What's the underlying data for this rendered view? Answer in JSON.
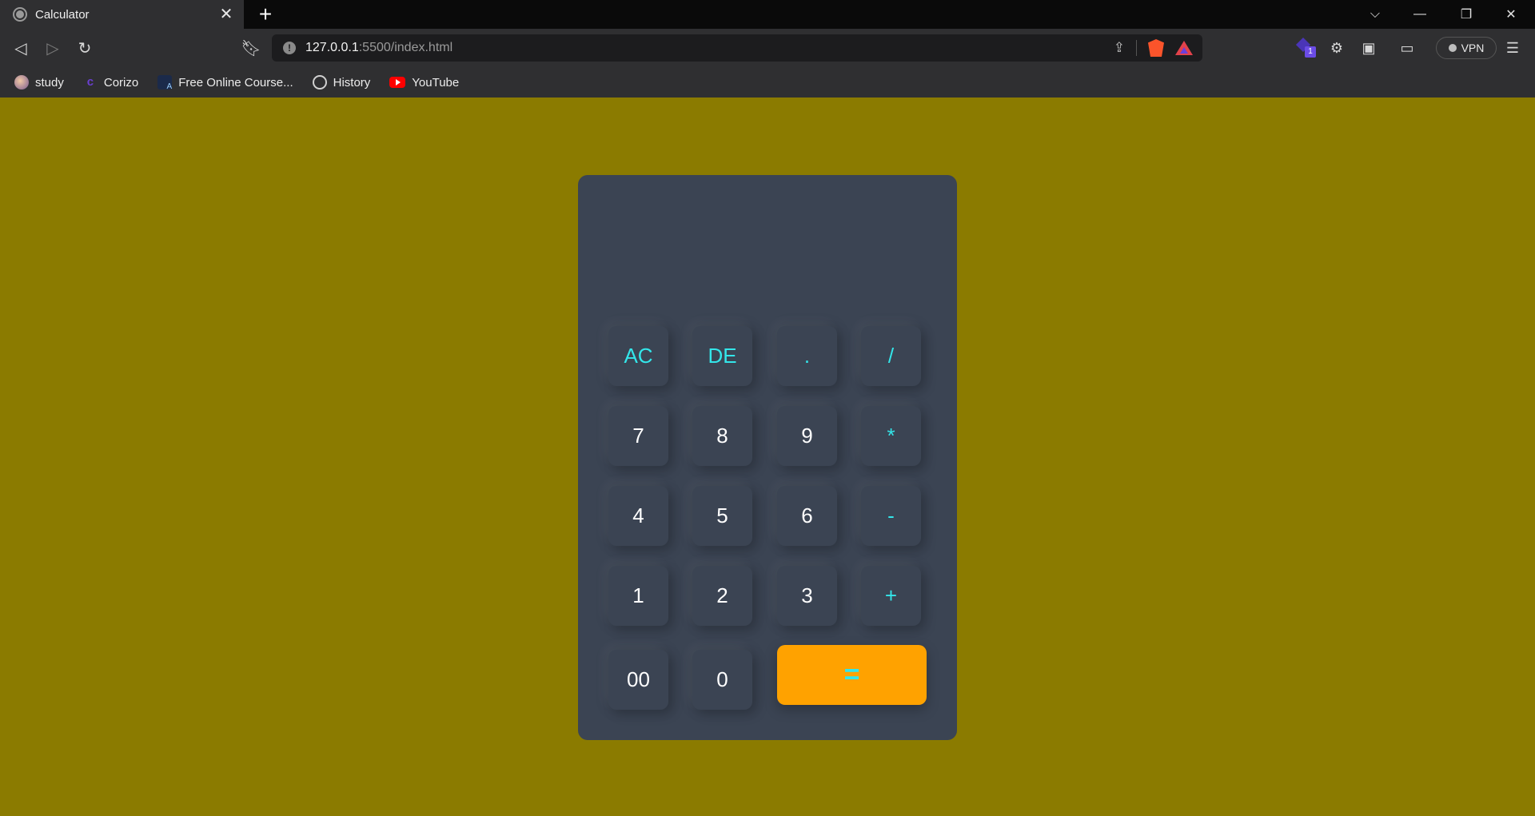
{
  "browser": {
    "tab_title": "Calculator",
    "url_host": "127.0.0.1",
    "url_rest": ":5500/index.html",
    "vpn_label": "VPN",
    "extension_badge": "1",
    "icons": [
      "globe-icon",
      "close-icon",
      "plus-icon",
      "back-icon",
      "forward-icon",
      "reload-icon",
      "bookmark-icon",
      "info-icon",
      "share-icon",
      "brave-shields-icon",
      "brave-rewards-icon",
      "extensions-icon",
      "sidebar-icon",
      "wallet-icon",
      "menu-icon"
    ]
  },
  "bookmarks": [
    {
      "label": "study"
    },
    {
      "label": "Corizo"
    },
    {
      "label": "Free Online Course..."
    },
    {
      "label": "History"
    },
    {
      "label": "YouTube"
    }
  ],
  "calculator": {
    "display_value": "",
    "keys": {
      "ac": "AC",
      "de": "DE",
      "dot": ".",
      "div": "/",
      "k7": "7",
      "k8": "8",
      "k9": "9",
      "mul": "*",
      "k4": "4",
      "k5": "5",
      "k6": "6",
      "sub": "-",
      "k1": "1",
      "k2": "2",
      "k3": "3",
      "add": "+",
      "k00": "00",
      "k0": "0",
      "eq": "="
    },
    "colors": {
      "page_background": "#8b7b00",
      "body": "#3b4453",
      "operator_text": "#33e6ea",
      "equals_button": "#ffa200"
    }
  }
}
